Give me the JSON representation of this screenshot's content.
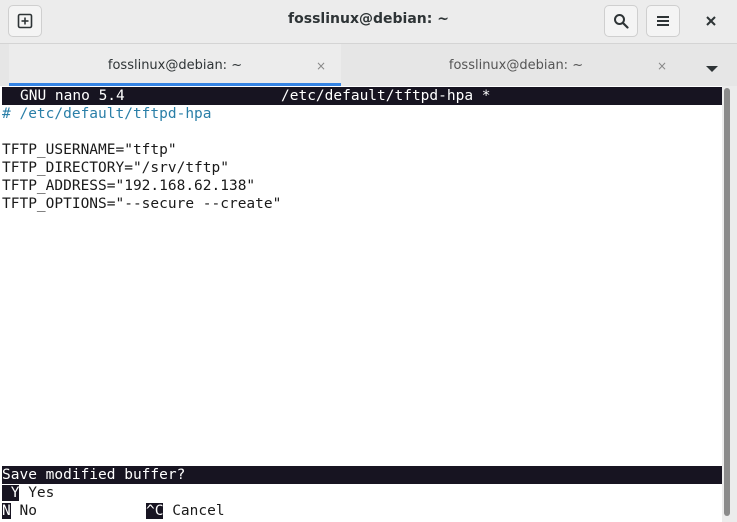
{
  "window": {
    "title": "fosslinux@debian: ~"
  },
  "tabs": [
    {
      "label": "fosslinux@debian: ~",
      "active": true
    },
    {
      "label": "fosslinux@debian: ~",
      "active": false
    }
  ],
  "icons": {
    "new_tab": "new-tab-icon",
    "search": "search-icon",
    "menu": "hamburger-menu-icon",
    "close": "close-icon",
    "tab_close": "×",
    "tab_dropdown": "chevron-down-icon"
  },
  "nano": {
    "version": "GNU nano 5.4",
    "filename": "/etc/default/tftpd-hpa *",
    "lines": [
      "# /etc/default/tftpd-hpa",
      "",
      "TFTP_USERNAME=\"tftp\"",
      "TFTP_DIRECTORY=\"/srv/tftp\"",
      "TFTP_ADDRESS=\"192.168.62.138\"",
      "TFTP_OPTIONS=\"--secure --create\""
    ],
    "prompt": "Save modified buffer?",
    "options": [
      {
        "key": "Y",
        "label": "Yes"
      },
      {
        "key": "N",
        "label": "No"
      },
      {
        "key": "^C",
        "label": "Cancel"
      }
    ]
  },
  "colors": {
    "accent": "#3584e4",
    "terminal_bg": "#ffffff",
    "inverse_bg": "#171421",
    "comment": "#2a7fa8"
  }
}
